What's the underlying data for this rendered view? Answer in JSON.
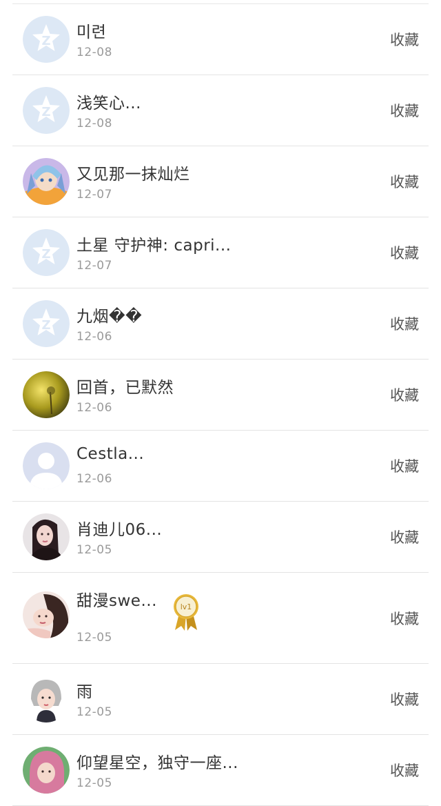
{
  "items": [
    {
      "name": "미련",
      "date": "12-08",
      "action": "收藏",
      "avatar": "default-qzone-avatar"
    },
    {
      "name": "浅笑心...",
      "date": "12-08",
      "action": "收藏",
      "avatar": "default-qzone-avatar"
    },
    {
      "name": "又见那一抹灿烂",
      "date": "12-07",
      "action": "收藏",
      "avatar": "anime-character-avatar"
    },
    {
      "name": "土星 守护神: capri...",
      "date": "12-07",
      "action": "收藏",
      "avatar": "default-qzone-avatar"
    },
    {
      "name": "九烟��",
      "date": "12-06",
      "action": "收藏",
      "avatar": "default-qzone-avatar"
    },
    {
      "name": "回首，已默然",
      "date": "12-06",
      "action": "收藏",
      "avatar": "golden-landscape-avatar"
    },
    {
      "name": "Cestla...",
      "date": "12-06",
      "action": "收藏",
      "avatar": "default-person-avatar"
    },
    {
      "name": "肖迪儿06...",
      "date": "12-05",
      "action": "收藏",
      "avatar": "woman-portrait-avatar"
    },
    {
      "name": "甜漫swe...",
      "date": "12-05",
      "action": "收藏",
      "avatar": "woman-portrait-avatar",
      "badge": "lv1"
    },
    {
      "name": "雨",
      "date": "12-05",
      "action": "收藏",
      "avatar": "cartoon-girl-avatar"
    },
    {
      "name": "仰望星空，独守一座...",
      "date": "12-05",
      "action": "收藏",
      "avatar": "pink-hair-avatar"
    }
  ],
  "colors": {
    "text": "#333333",
    "date": "#9a9a9a",
    "divider": "#e3e3e3",
    "default_avatar": "#dde8f5"
  }
}
